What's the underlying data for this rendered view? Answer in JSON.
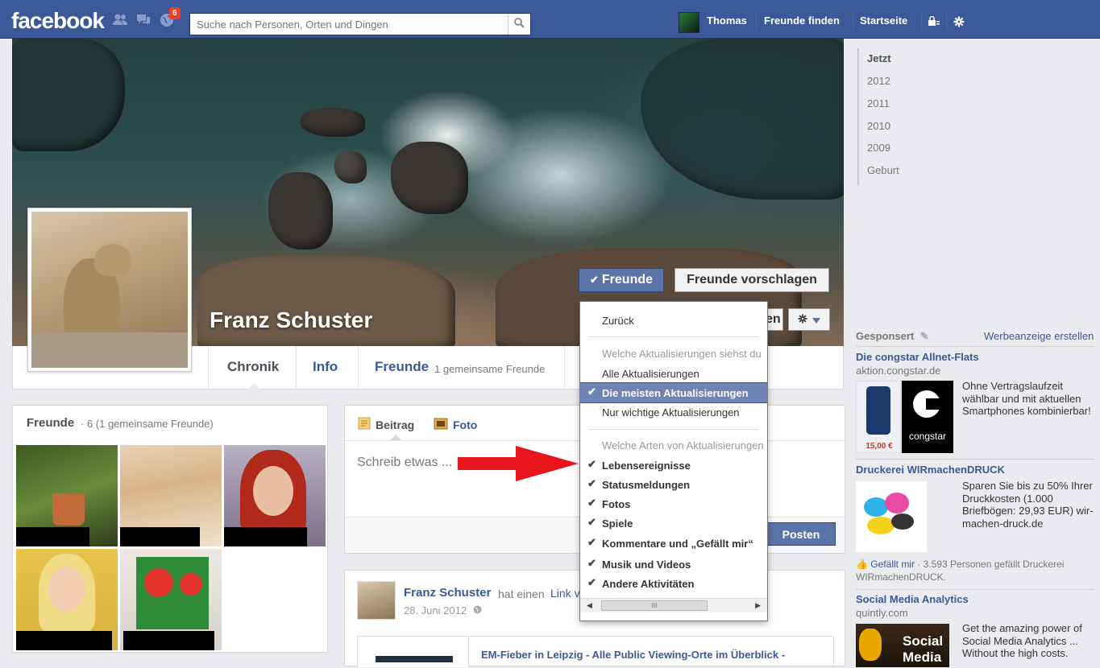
{
  "topbar": {
    "logo": "facebook",
    "notification_count": "6",
    "search_placeholder": "Suche nach Personen, Orten und Dingen",
    "user_name": "Thomas",
    "find_friends": "Freunde finden",
    "home": "Startseite"
  },
  "profile": {
    "name": "Franz Schuster",
    "friends_button": "Freunde",
    "suggest_button": "Freunde vorschlagen",
    "message_button_partial": "en"
  },
  "tabs": {
    "chronik": "Chronik",
    "info": "Info",
    "freunde": "Freunde",
    "freunde_sub": "1 gemeinsame Freunde"
  },
  "friends_box": {
    "title": "Freunde",
    "subtitle": "· 6 (1 gemeinsame Freunde)"
  },
  "composer": {
    "tab_post": "Beitrag",
    "tab_photo": "Foto",
    "placeholder": "Schreib etwas ...",
    "post_button": "Posten"
  },
  "story": {
    "author": "Franz Schuster",
    "action": "hat einen",
    "link": "Link v",
    "date": "28. Juni 2012",
    "card_title": "EM-Fieber in Leipzig - Alle Public Viewing-Orte im Überblick -"
  },
  "menu": {
    "back": "Zurück",
    "updates_header": "Welche Aktualisierungen siehst du",
    "all_updates": "Alle Aktualisierungen",
    "most_updates": "Die meisten Aktualisierungen",
    "important_updates": "Nur wichtige Aktualisierungen",
    "types_header": "Welche Arten von Aktualisierungen",
    "life_events": "Lebensereignisse",
    "status": "Statusmeldungen",
    "photos": "Fotos",
    "games": "Spiele",
    "comments_likes": "Kommentare und „Gefällt mir“",
    "music_videos": "Musik und Videos",
    "other": "Andere Aktivitäten"
  },
  "timeline": [
    "Jetzt",
    "2012",
    "2011",
    "2010",
    "2009",
    "Geburt"
  ],
  "ads": {
    "sponsored": "Gesponsert",
    "create_ad": "Werbeanzeige erstellen",
    "items": [
      {
        "title": "Die congstar Allnet-Flats",
        "domain": "aktion.congstar.de",
        "body": "Ohne Vertragslaufzeit wählbar und mit aktuellen Smartphones kombinierbar!",
        "price": "15,00 €",
        "brand": "congstar"
      },
      {
        "title": "Druckerei WIRmachenDRUCK",
        "body": "Sparen Sie bis zu 50% Ihrer Druckkosten (1.000 Briefbögen: 29,93 EUR) wir-machen-druck.de",
        "like_label": "Gefällt mir",
        "like_text": "· 3.593 Personen gefällt Druckerei WIRmachenDRUCK."
      },
      {
        "title": "Social Media Analytics",
        "domain": "quintly.com",
        "body": "Get the amazing power of Social Media Analytics ... Without the high costs.",
        "image_text": "Social Media"
      }
    ]
  }
}
